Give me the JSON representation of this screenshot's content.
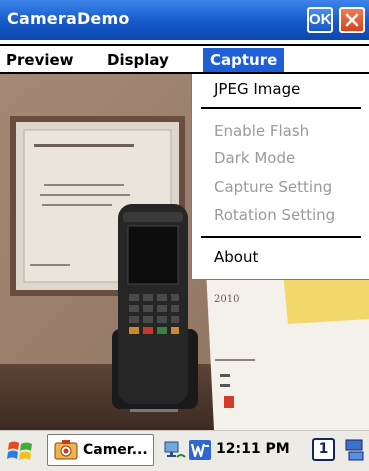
{
  "window": {
    "title": "CameraDemo",
    "ok_label": "OK"
  },
  "menubar": {
    "items": [
      {
        "label": "Preview"
      },
      {
        "label": "Display"
      },
      {
        "label": "Capture"
      }
    ],
    "active_index": 2
  },
  "capture_menu": {
    "items": [
      {
        "label": "JPEG Image",
        "enabled": true
      },
      {
        "label": "Enable Flash",
        "enabled": false
      },
      {
        "label": "Dark Mode",
        "enabled": false
      },
      {
        "label": "Capture Setting",
        "enabled": false
      },
      {
        "label": "Rotation Setting",
        "enabled": false
      },
      {
        "label": "About",
        "enabled": true
      }
    ]
  },
  "preview_photo": {
    "visible_text": [
      "2010"
    ]
  },
  "taskbar": {
    "task_label": "Camer...",
    "clock": "12:11 PM",
    "input_indicator": "1"
  },
  "colors": {
    "titlebar": "#1559c9",
    "menu_highlight": "#1f5fd6",
    "close_button": "#d8431d",
    "disabled_text": "#9a9a9a",
    "taskbar": "#ecebe6"
  }
}
